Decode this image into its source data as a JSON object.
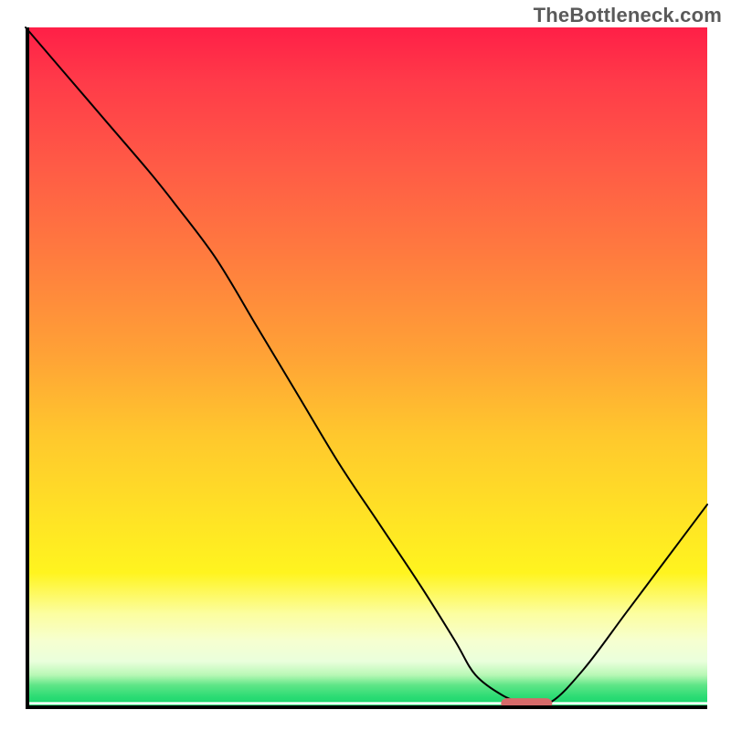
{
  "watermark": "TheBottleneck.com",
  "chart_data": {
    "type": "line",
    "title": "",
    "xlabel": "",
    "ylabel": "",
    "xlim": [
      0,
      100
    ],
    "ylim": [
      0,
      100
    ],
    "grid": false,
    "legend": false,
    "series": [
      {
        "name": "bottleneck-curve",
        "x": [
          0,
          6,
          12,
          18,
          22,
          28,
          34,
          40,
          46,
          52,
          58,
          63,
          66,
          70,
          73,
          77,
          82,
          88,
          94,
          100
        ],
        "y": [
          100,
          93,
          86,
          79,
          74,
          66,
          56,
          46,
          36,
          27,
          18,
          10,
          5,
          2,
          1,
          1,
          6,
          14,
          22,
          30
        ]
      }
    ],
    "marker": {
      "name": "optimal-marker",
      "x_center": 73.5,
      "y": 0.8,
      "width": 7.5,
      "color": "#d66a6a"
    },
    "background_gradient_stops": [
      {
        "pos": 0.0,
        "color": "#ff1f47"
      },
      {
        "pos": 0.33,
        "color": "#ff7a3f"
      },
      {
        "pos": 0.6,
        "color": "#ffc82d"
      },
      {
        "pos": 0.8,
        "color": "#fff41f"
      },
      {
        "pos": 0.9,
        "color": "#f6ffd0"
      },
      {
        "pos": 0.965,
        "color": "#5ee587"
      },
      {
        "pos": 0.989,
        "color": "#21d870"
      },
      {
        "pos": 0.991,
        "color": "#ffffff"
      },
      {
        "pos": 0.994,
        "color": "#2bdc74"
      },
      {
        "pos": 1.0,
        "color": "#26d86f"
      }
    ]
  }
}
